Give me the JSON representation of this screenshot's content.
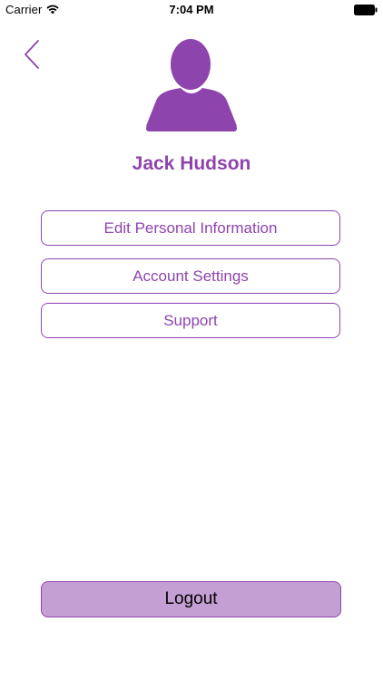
{
  "status_bar": {
    "carrier": "Carrier",
    "time": "7:04 PM",
    "wifi_icon": "wifi-icon",
    "battery_icon": "battery-icon"
  },
  "nav": {
    "back_icon": "chevron-left-icon"
  },
  "profile": {
    "avatar_icon": "user-silhouette-icon",
    "name": "Jack Hudson"
  },
  "menu": {
    "items": [
      {
        "label": "Edit Personal Information"
      },
      {
        "label": "Account Settings"
      },
      {
        "label": "Support"
      }
    ]
  },
  "footer": {
    "logout_label": "Logout"
  },
  "colors": {
    "accent": "#8e44ad",
    "logout_fill": "#c49fd4",
    "background": "#ffffff"
  }
}
